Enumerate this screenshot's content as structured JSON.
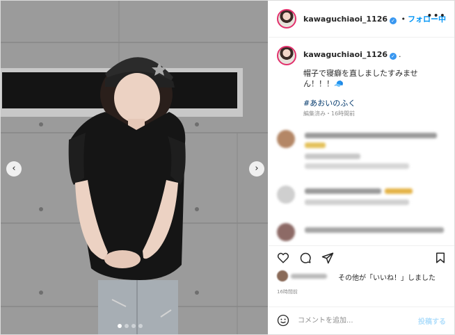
{
  "post": {
    "username": "kawaguchiaoi_1126",
    "follow_label": "フォロー中",
    "separator": "•",
    "more_icon": "more-horizontal-icon",
    "verified_icon": "verified-badge-icon"
  },
  "media": {
    "prev_icon": "chevron-left-icon",
    "next_icon": "chevron-right-icon",
    "prev_glyph": "‹",
    "next_glyph": "›",
    "carousel_total": 4,
    "carousel_active": 1
  },
  "caption": {
    "username": "kawaguchiaoi_1126",
    "suffix": ".",
    "text": "帽子で寝癖を直しましたすみません！！！🧢",
    "hashtag": "#あおいのふく",
    "meta": "編集済み・16時間前"
  },
  "actions": {
    "like_icon": "heart-icon",
    "comment_icon": "comment-icon",
    "share_icon": "share-icon",
    "save_icon": "bookmark-icon"
  },
  "likes": {
    "text": "その他が「いいね！」しました"
  },
  "time": {
    "text": "16時間前"
  },
  "comment_box": {
    "emoji_icon": "emoji-icon",
    "placeholder": "コメントを追加...",
    "post_label": "投稿する"
  },
  "colors": {
    "accent": "#0095f6",
    "verified": "#3897f0",
    "text": "#262626",
    "muted": "#8e8e8e"
  }
}
